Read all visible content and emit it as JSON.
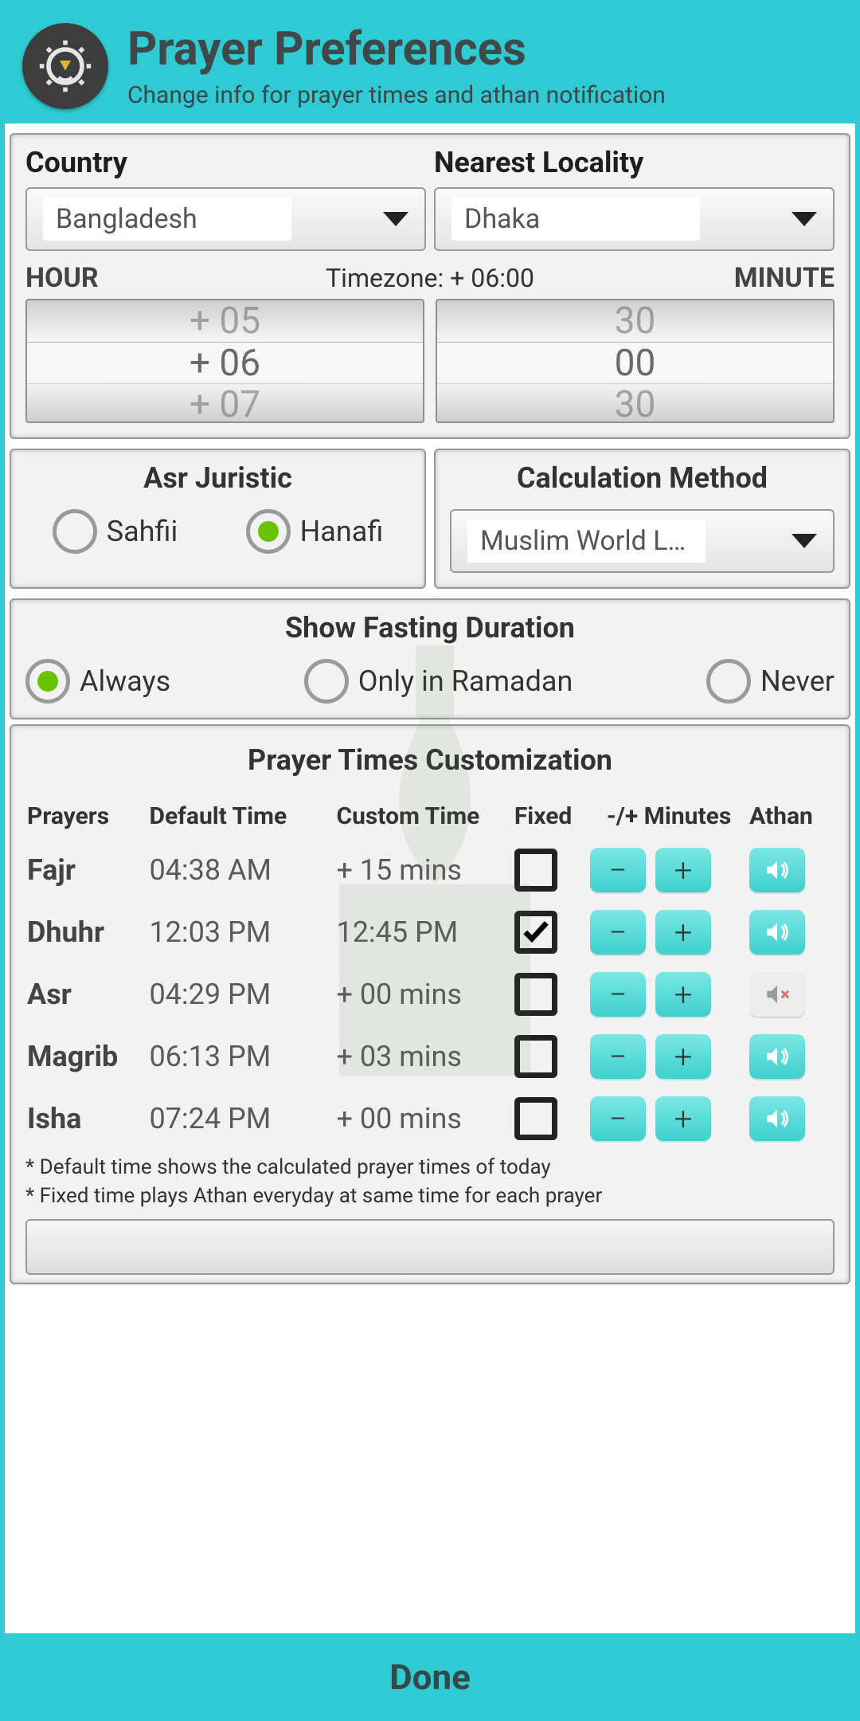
{
  "header": {
    "title": "Prayer Preferences",
    "subtitle": "Change info for prayer times and athan notification"
  },
  "location": {
    "country_label": "Country",
    "country_value": "Bangladesh",
    "locality_label": "Nearest Locality",
    "locality_value": "Dhaka",
    "hour_label": "HOUR",
    "minute_label": "MINUTE",
    "tz_text": "Timezone: + 06:00",
    "hour_prev": "+ 05",
    "hour_sel": "+ 06",
    "hour_next": "+ 07",
    "min_prev": "30",
    "min_sel": "00",
    "min_next": "30"
  },
  "asr": {
    "title": "Asr Juristic",
    "opt1": "Sahfii",
    "opt2": "Hanafi",
    "selected": "Hanafi"
  },
  "calc": {
    "title": "Calculation Method",
    "value": "Muslim World L…"
  },
  "fasting": {
    "title": "Show Fasting Duration",
    "opt1": "Always",
    "opt2": "Only in Ramadan",
    "opt3": "Never",
    "selected": "Always"
  },
  "customization": {
    "title": "Prayer Times Customization",
    "columns": {
      "prayers": "Prayers",
      "default": "Default Time",
      "custom": "Custom Time",
      "fixed": "Fixed",
      "minutes": "-/+ Minutes",
      "athan": "Athan"
    },
    "rows": [
      {
        "name": "Fajr",
        "default": "04:38 AM",
        "custom": "+ 15 mins",
        "fixed": false,
        "athan": "on"
      },
      {
        "name": "Dhuhr",
        "default": "12:03 PM",
        "custom": "12:45 PM",
        "fixed": true,
        "athan": "on"
      },
      {
        "name": "Asr",
        "default": "04:29 PM",
        "custom": "+ 00 mins",
        "fixed": false,
        "athan": "off"
      },
      {
        "name": "Magrib",
        "default": "06:13 PM",
        "custom": "+ 03 mins",
        "fixed": false,
        "athan": "on"
      },
      {
        "name": "Isha",
        "default": "07:24 PM",
        "custom": "+ 00 mins",
        "fixed": false,
        "athan": "on"
      }
    ],
    "note1": "* Default time shows the calculated prayer times of today",
    "note2": "* Fixed time plays Athan everyday at same time for each prayer"
  },
  "done_label": "Done"
}
